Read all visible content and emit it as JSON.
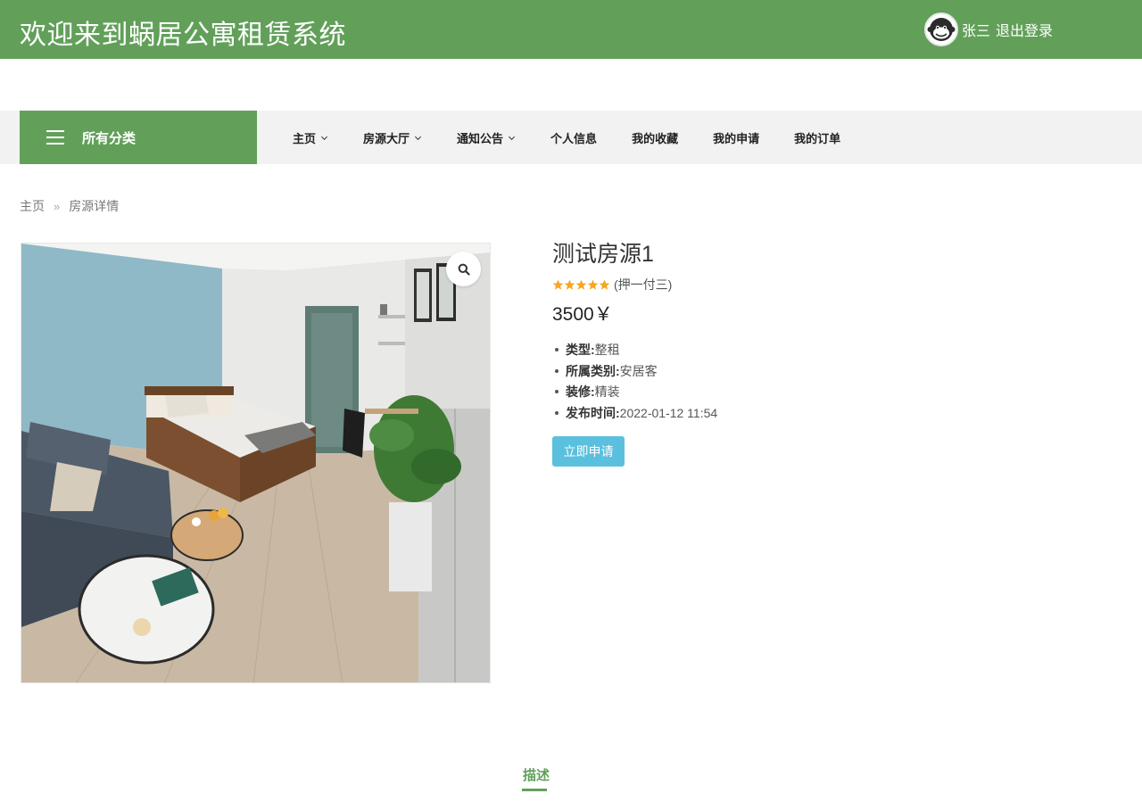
{
  "header": {
    "site_title": "欢迎来到蜗居公寓租赁系统",
    "user_name": "张三",
    "logout_label": "退出登录"
  },
  "nav": {
    "categories_label": "所有分类",
    "items": [
      {
        "label": "主页",
        "has_dropdown": true
      },
      {
        "label": "房源大厅",
        "has_dropdown": true
      },
      {
        "label": "通知公告",
        "has_dropdown": true
      },
      {
        "label": "个人信息",
        "has_dropdown": false
      },
      {
        "label": "我的收藏",
        "has_dropdown": false
      },
      {
        "label": "我的申请",
        "has_dropdown": false
      },
      {
        "label": "我的订单",
        "has_dropdown": false
      }
    ]
  },
  "breadcrumb": {
    "home": "主页",
    "separator": "»",
    "current": "房源详情"
  },
  "product": {
    "title": "测试房源1",
    "rating_stars": 5,
    "payment_terms": "(押一付三)",
    "price": "3500￥",
    "attributes": [
      {
        "key": "类型:",
        "value": "整租"
      },
      {
        "key": "所属类别:",
        "value": "安居客"
      },
      {
        "key": "装修:",
        "value": "精装"
      },
      {
        "key": "发布时间:",
        "value": "2022-01-12 11:54"
      }
    ],
    "apply_label": "立即申请"
  },
  "tabs": {
    "description_label": "描述"
  },
  "colors": {
    "brand_green": "#62a05a",
    "apply_button": "#5bc0de",
    "star": "#f5a623",
    "nav_bg": "#f2f2f2"
  },
  "icons": {
    "menu": "hamburger-icon",
    "chevron": "chevron-down-icon",
    "zoom": "search-icon",
    "avatar": "monkey-avatar-icon"
  }
}
